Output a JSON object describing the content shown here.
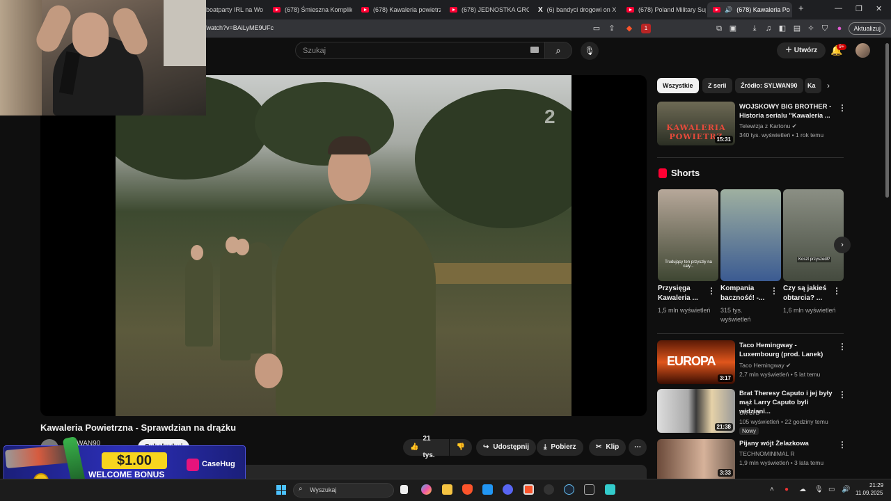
{
  "browser": {
    "tabs": [
      {
        "label": "boatparty IRL na Wo"
      },
      {
        "label": "(678) Śmieszna Komplikac"
      },
      {
        "label": "(678) Kawaleria powietrzn"
      },
      {
        "label": "(678) JEDNOSTKA GROM"
      },
      {
        "label": "(6) bandyci drogowi on X"
      },
      {
        "label": "(678) Poland Military Supe"
      },
      {
        "label": "(678) Kawaleria Po"
      }
    ],
    "new_tab": "+",
    "window_controls": {
      "minimize": "—",
      "restore": "❐",
      "close": "✕"
    },
    "url": "/watch?v=BAiLyME9UFc",
    "update_label": "Aktualizuj",
    "extension_badge": "1"
  },
  "youtube_header": {
    "search_placeholder": "Szukaj",
    "create_label": "Utwórz",
    "notifications_count": "9+"
  },
  "video": {
    "title": "Kawaleria Powietrzna - Sprawdzian na drążku",
    "channel_name": "SYLWAN90",
    "overlay_logo": "2",
    "likes": "21 tys.",
    "share_label": "Udostępnij",
    "download_label": "Pobierz",
    "clip_label": "Klip",
    "more_label": "⋯",
    "subscribe_label": "Subskrybuj"
  },
  "promo": {
    "amount": "$1.00",
    "label": "WELCOME BONUS",
    "brand": "CaseHug"
  },
  "sidebar": {
    "chips": [
      {
        "label": "Wszystkie"
      },
      {
        "label": "Z serii"
      },
      {
        "label": "Źródło: SYLWAN90"
      },
      {
        "label": "Ka"
      }
    ],
    "first_item": {
      "title": "WOJSKOWY BIG BROTHER - Historia serialu \"Kawaleria ...",
      "channel": "Telewizja z Kartonu",
      "meta": "340 tys. wyświetleń • 1 rok temu",
      "duration": "15:31",
      "thumb_text": "KAWALERIA POWIETRZ"
    },
    "shorts_heading": "Shorts",
    "shorts": [
      {
        "title": "Przysięga Kawaleria ...",
        "views": "1,5 mln wyświetleń",
        "caption": "Trudujący ten przyszły na cały..."
      },
      {
        "title": "Kompania baczność! -...",
        "views": "315 tys. wyświetleń",
        "caption": ""
      },
      {
        "title": "Czy są jakieś obtarcia? ...",
        "views": "1,6 mln wyświetleń",
        "caption": "Koszt przyszedł?"
      }
    ],
    "items": [
      {
        "title": "Taco Hemingway - Luxembourg (prod. Lanek)",
        "channel": "Taco Hemingway",
        "meta": "2,7 mln wyświetleń • 5 lat temu",
        "duration": "3:17",
        "thumb_text": "EUROPA",
        "badge": ""
      },
      {
        "title": "Brat Theresy Caputo i jej były mąż Larry Caputo byli widziani...",
        "channel": "UK LTD",
        "meta": "105 wyświetleń • 22 godziny temu",
        "duration": "21:38",
        "thumb_text": "",
        "badge": "Nowy"
      },
      {
        "title": "Pijany wójt Żelazkowa",
        "channel": "TECHNOMINIMAL R",
        "meta": "1,9 mln wyświetleń • 3 lata temu",
        "duration": "3:33",
        "thumb_text": "",
        "badge": ""
      }
    ]
  },
  "taskbar": {
    "search_placeholder": "Wyszukaj",
    "time": "21:29",
    "date": "11.09.2025"
  }
}
